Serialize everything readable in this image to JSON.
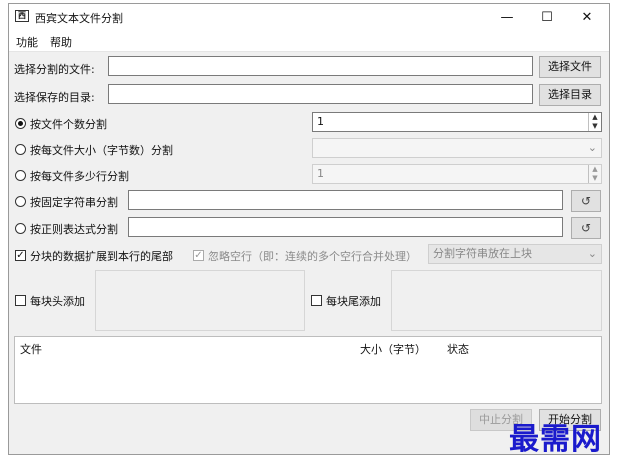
{
  "window": {
    "title": "西宾文本文件分割",
    "icon_text": "西",
    "minimize_glyph": "—",
    "maximize_glyph": "☐",
    "close_glyph": "✕"
  },
  "menu": {
    "items": [
      {
        "label": "功能"
      },
      {
        "label": "帮助"
      }
    ]
  },
  "select_file": {
    "label": "选择分割的文件:",
    "value": "",
    "button": "选择文件"
  },
  "select_dir": {
    "label": "选择保存的目录:",
    "value": "",
    "button": "选择目录"
  },
  "options": {
    "by_count": {
      "label": "按文件个数分割",
      "value": "1",
      "checked": true
    },
    "by_size": {
      "label": "按每文件大小（字节数）分割",
      "value": ""
    },
    "by_lines": {
      "label": "按每文件多少行分割",
      "value": "1"
    },
    "by_string": {
      "label": "按固定字符串分割",
      "value": ""
    },
    "by_regex": {
      "label": "按正则表达式分割",
      "value": ""
    }
  },
  "extend_block": {
    "label": "分块的数据扩展到本行的尾部",
    "checked": true
  },
  "skip_empty": {
    "label": "忽略空行（即：连续的多个空行合并处理）",
    "checked": true
  },
  "split_position": {
    "selected": "分割字符串放在上块"
  },
  "header_add": {
    "label": "每块头添加",
    "checked": false
  },
  "footer_add": {
    "label": "每块尾添加",
    "checked": false
  },
  "table": {
    "columns": [
      "文件",
      "大小（字节）",
      "状态"
    ],
    "rows": []
  },
  "buttons": {
    "stop": "中止分割",
    "start": "开始分割"
  },
  "watermark": "最需网",
  "icons": {
    "reset": "reset-icon",
    "spin_up": "▲",
    "spin_down": "▼",
    "dropdown": "⌄"
  }
}
